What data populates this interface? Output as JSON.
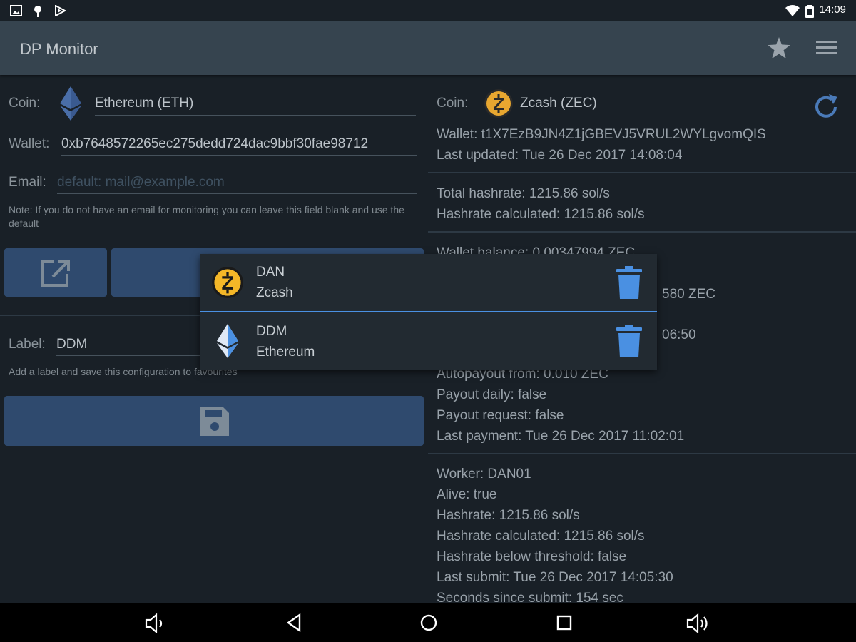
{
  "status_bar": {
    "time": "14:09",
    "icons": [
      "image-icon",
      "pin-icon",
      "play-icon",
      "wifi-icon",
      "battery-icon"
    ]
  },
  "app_bar": {
    "title": "DP Monitor",
    "actions": [
      "star-icon",
      "menu-icon"
    ]
  },
  "form": {
    "coin_label": "Coin:",
    "coin_value": "Ethereum (ETH)",
    "wallet_label": "Wallet:",
    "wallet_value": "0xb7648572265ec275dedd724dac9bbf30fae98712",
    "email_label": "Email:",
    "email_placeholder": "default: mail@example.com",
    "note": "Note: If you do not have an email for monitoring you can leave this field blank and use the default",
    "label_label": "Label:",
    "label_value": "DDM",
    "label_hint": "Add a label and save this configuration to favourites"
  },
  "status_panel": {
    "coin_label": "Coin:",
    "coin_value": "Zcash (ZEC)",
    "wallet": "Wallet: t1X7EzB9JN4Z1jGBEVJ5VRUL2WYLgvomQIS",
    "last_updated": "Last updated: Tue 26 Dec 2017 14:08:04",
    "total_hashrate": "Total hashrate: 1215.86 sol/s",
    "hashrate_calculated": "Hashrate calculated: 1215.86 sol/s",
    "wallet_balance": "Wallet balance: 0.00347994 ZEC",
    "hidden_value_1": "580 ZEC",
    "hidden_value_2": "06:50",
    "autopayout_from": "Autopayout from: 0.010 ZEC",
    "payout_daily": "Payout daily: false",
    "payout_request": "Payout request: false",
    "last_payment": "Last payment: Tue 26 Dec 2017 11:02:01",
    "worker": "Worker: DAN01",
    "alive": "Alive: true",
    "worker_hashrate": "Hashrate: 1215.86 sol/s",
    "worker_hashrate_calculated": "Hashrate calculated: 1215.86 sol/s",
    "hashrate_below_threshold": "Hashrate below threshold: false",
    "last_submit": "Last submit: Tue 26 Dec 2017 14:05:30",
    "seconds_since_submit": "Seconds since submit: 154 sec"
  },
  "favourites": [
    {
      "label": "DAN",
      "coin": "Zcash",
      "icon": "zcash-icon"
    },
    {
      "label": "DDM",
      "coin": "Ethereum",
      "icon": "ethereum-icon"
    }
  ],
  "nav_bar": {
    "buttons": [
      "volume-down-icon",
      "back-icon",
      "home-icon",
      "recents-icon",
      "volume-up-icon"
    ]
  },
  "colors": {
    "app_bar": "#36444f",
    "background": "#192027",
    "button": "#2f4a6e",
    "accent": "#4a90e2",
    "delete": "#4a90e2",
    "zcash": "#f4b728"
  }
}
